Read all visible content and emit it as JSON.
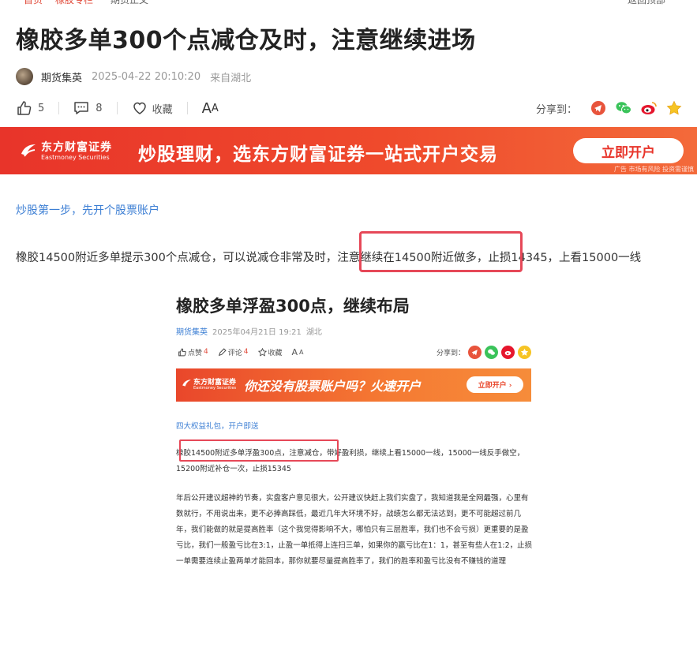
{
  "breadcrumb": [
    "首页",
    "橡胶专栏",
    "期货正文",
    "返回顶部"
  ],
  "article": {
    "title": "橡胶多单300个点减仓及时，注意继续进场",
    "author": "期货集英",
    "date": "2025-04-22 20:10:20",
    "location": "来自湖北",
    "likes": "5",
    "comments": "8",
    "favorite_label": "收藏",
    "font_label_big": "A",
    "font_label_small": "A",
    "share_label": "分享到：",
    "share_icons": [
      "telegram-like-icon",
      "wechat-icon",
      "weibo-icon",
      "star-icon"
    ]
  },
  "banner": {
    "brand": "东方财富证券",
    "brand_en": "Eastmoney Securities",
    "slogan": "炒股理财，选东方财富证券一站式开户交易",
    "button": "立即开户",
    "ad_note": "广告 市场有风险 投资需谨慎",
    "colors": {
      "bg": "#e8342a",
      "button_text": "#e8342a"
    }
  },
  "content": {
    "link": "炒股第一步，先开个股票账户",
    "paragraph": "橡胶14500附近多单提示300个点减仓，可以说减仓非常及时，注意继续在14500附近做多，止损14345，上看15000一线",
    "highlight_color": "#e64858"
  },
  "embedded": {
    "title": "橡胶多单浮盈300点，继续布局",
    "author": "期货集英",
    "date": "2025年04月21日 19:21",
    "location": "湖北",
    "like_label": "点赞",
    "like_count": "4",
    "comment_label": "评论",
    "comment_count": "4",
    "favorite_label": "收藏",
    "font_label": "A",
    "share_label": "分享到：",
    "banner_brand": "东方财富证券",
    "banner_brand_en": "Eastmoney Securities",
    "banner_slogan": "你还没有股票账户吗？火速开户",
    "banner_button": "立即开户 ›",
    "link": "四大权益礼包，开户即送",
    "paragraph1": "橡胶14500附近多单浮盈300点，注意减仓，带好盈利损，继续上看15000一线，15000一线反手做空，15200附近补仓一次，止损15345",
    "paragraph2": "年后公开建议超神的节奏，实盘客户意见很大，公开建议快赶上我们实盘了，我知道我是全网最强，心里有数就行，不用说出来，更不必捧高踩低，最近几年大环境不好，战绩怎么都无法达到，更不可能超过前几年，我们能做的就是提高胜率（这个我觉得影响不大，哪怕只有三层胜率，我们也不会亏损）更重要的是盈亏比，我们一般盈亏比在3:1，止盈一单抵得上连扫三单，如果你的赢亏比在1：1，甚至有些人在1:2，止损一单需要连续止盈两单才能回本，那你就要尽量提高胜率了，我们的胜率和盈亏比没有不赚钱的道理"
  }
}
